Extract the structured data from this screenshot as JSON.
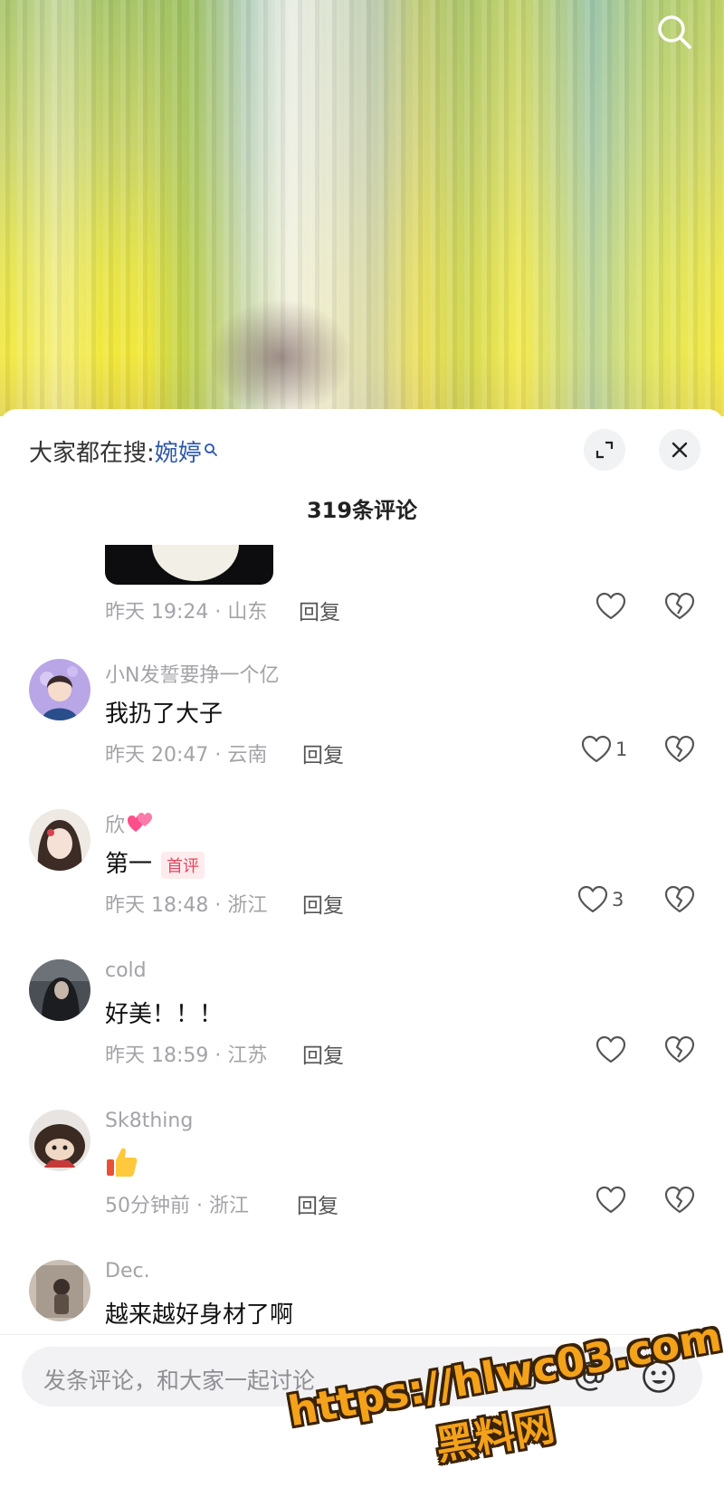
{
  "video": {
    "search_icon": "search-icon"
  },
  "header": {
    "hot_search_prefix": "大家都在搜:",
    "hot_search_keyword": "婉婷",
    "expand_icon": "expand-icon",
    "close_icon": "close-icon",
    "comment_count": "319条评论"
  },
  "comments": [
    {
      "username": "",
      "text": "",
      "time": "昨天 19:24",
      "location": "山东",
      "meta": "昨天 19:24 · 山东",
      "reply_label": "回复",
      "likes": "",
      "has_image": true
    },
    {
      "username": "小N发誓要挣一个亿",
      "text": "我扔了大子",
      "meta": "昨天 20:47 · 云南",
      "reply_label": "回复",
      "likes": "1"
    },
    {
      "username": "欣",
      "username_emoji": "heart-emoji",
      "text": "第一",
      "badge": "首评",
      "meta": "昨天 18:48 · 浙江",
      "reply_label": "回复",
      "likes": "3"
    },
    {
      "username": "cold",
      "text": "好美！！！",
      "meta": "昨天 18:59 · 江苏",
      "reply_label": "回复",
      "likes": ""
    },
    {
      "username": "Sk8thing",
      "text_emoji": "thumbs-up-emoji",
      "meta": "50分钟前 · 浙江",
      "reply_label": "回复",
      "likes": ""
    },
    {
      "username": "Dec.",
      "text": "越来越好身材了啊"
    }
  ],
  "input_bar": {
    "placeholder": "发条评论，和大家一起讨论",
    "image_icon": "image-icon",
    "at_icon": "at-icon",
    "emoji_icon": "emoji-icon"
  },
  "watermark": {
    "line1": "https://hlwc03.com",
    "line2": "黑料网"
  }
}
